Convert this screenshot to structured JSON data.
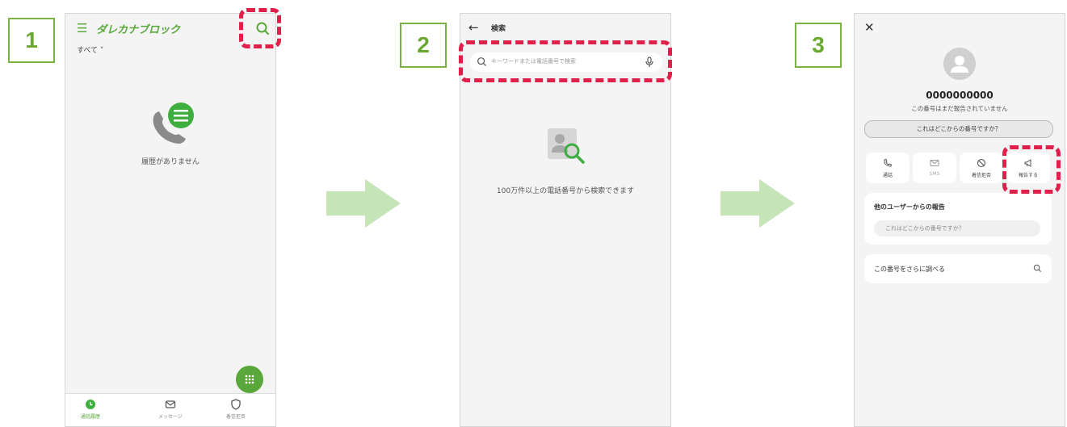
{
  "steps": [
    "1",
    "2",
    "3"
  ],
  "colors": {
    "accent": "#5aa83b",
    "highlight": "#e0204a",
    "arrow": "#c5e4b8"
  },
  "screen1": {
    "brand": "ダレカナブロック",
    "filter": "すべて ˅",
    "empty_text": "履歴がありません",
    "icons": [
      "menu-icon",
      "search-icon",
      "phone-message-icon",
      "dialpad-icon"
    ],
    "nav": [
      {
        "label": "通話履歴",
        "icon": "clock-icon"
      },
      {
        "label": "メッセージ",
        "icon": "message-icon"
      },
      {
        "label": "着信拒否",
        "icon": "shield-icon"
      }
    ]
  },
  "screen2": {
    "title": "検索",
    "search_placeholder": "キーワードまたは電話番号で検索",
    "note": "100万件以上の電話番号から検索できます"
  },
  "screen3": {
    "number": "0000000000",
    "not_reported": "この番号はまだ報告されていません",
    "where_button": "これはどこからの番号ですか？",
    "actions": [
      {
        "label": "通話",
        "icon": "phone-icon"
      },
      {
        "label": "SMS",
        "icon": "mail-icon"
      },
      {
        "label": "着信拒否",
        "icon": "block-icon"
      },
      {
        "label": "報告する",
        "icon": "megaphone-icon"
      }
    ],
    "other_reports_title": "他のユーザーからの報告",
    "other_reports_input": "これはどこからの番号ですか？",
    "lookup_label": "この番号をさらに調べる"
  }
}
